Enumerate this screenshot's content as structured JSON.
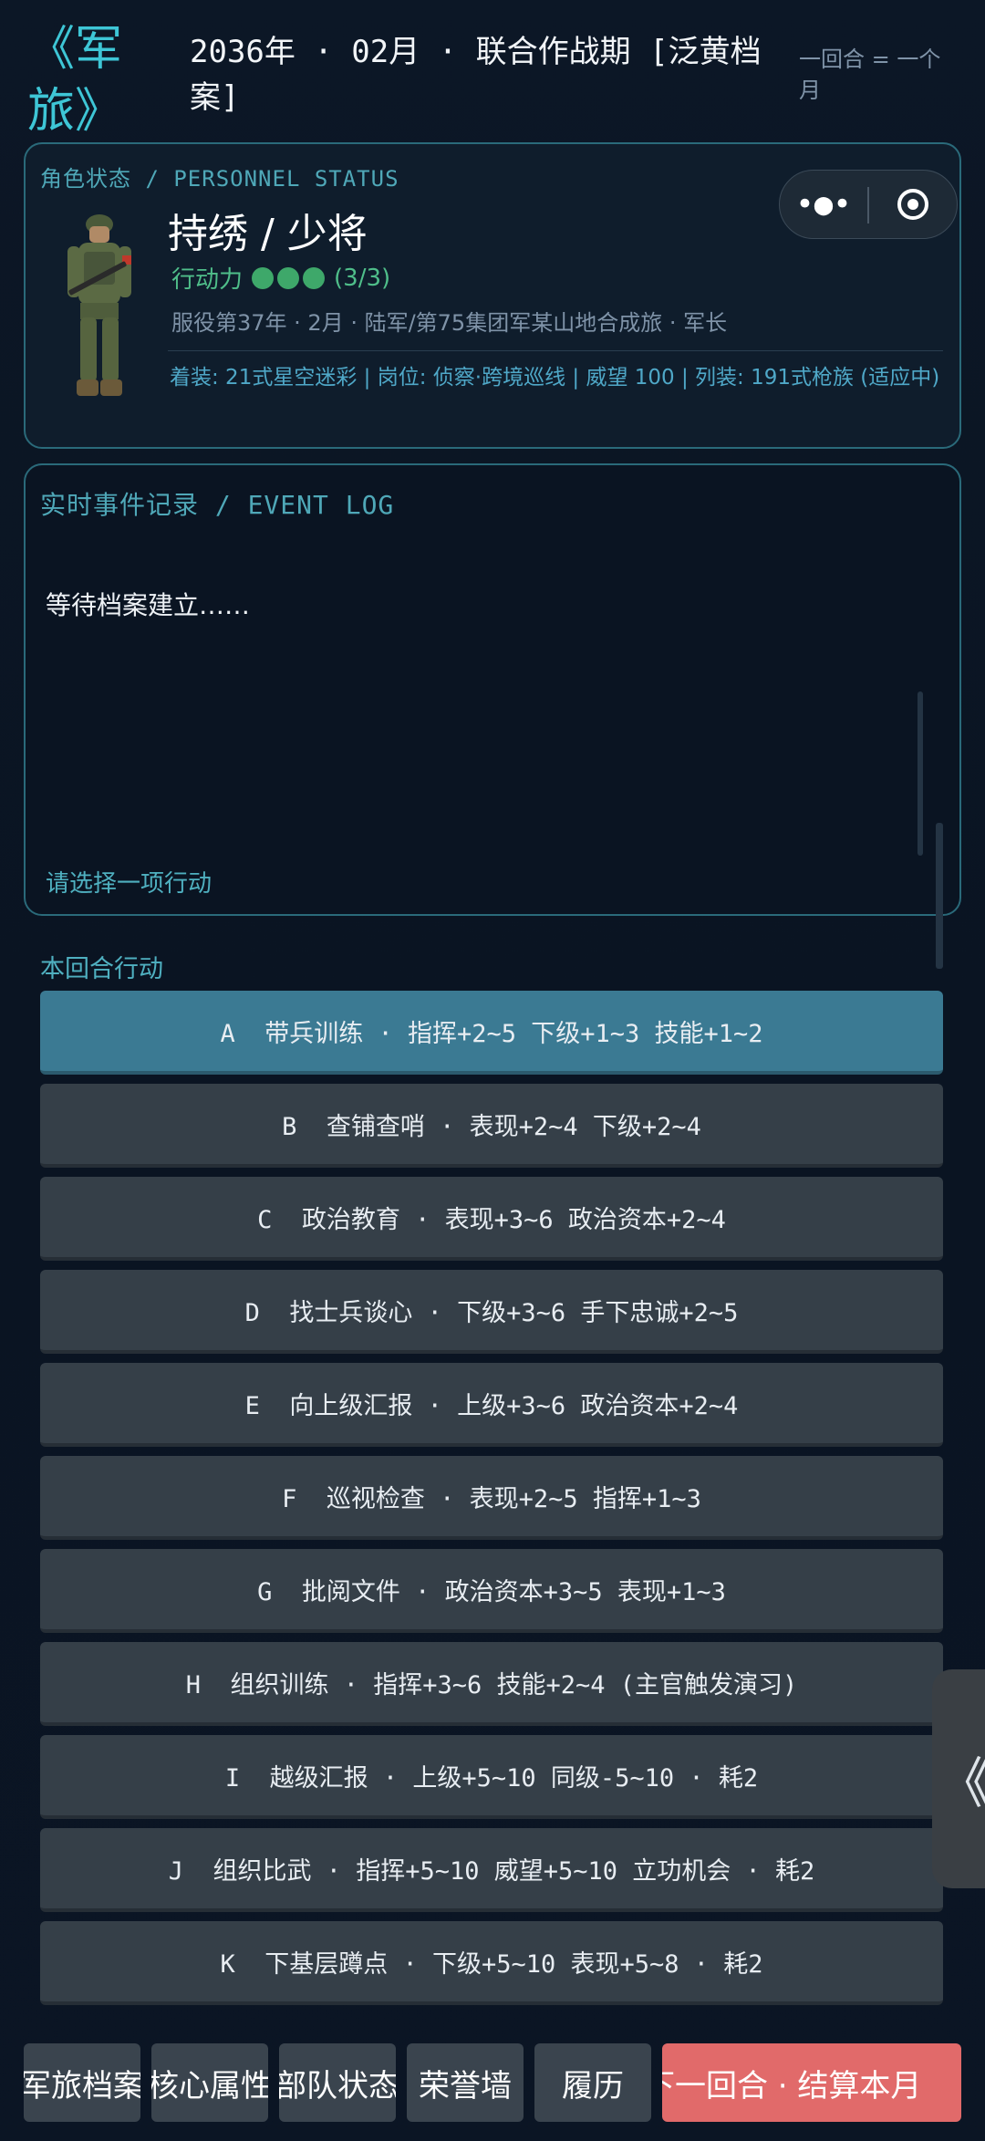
{
  "header": {
    "logo": "《军旅》",
    "date_line": "2036年 · 02月 · 联合作战期 [泛黄档案]",
    "period_note": "一回合 = 一个月"
  },
  "personnel": {
    "section_label": "角色状态 / PERSONNEL STATUS",
    "name_rank": "持绣  /  少将",
    "action_label": "行动力",
    "action_points": 3,
    "action_count": "(3/3)",
    "service": "服役第37年 · 2月 · 陆军/第75集团军某山地合成旅 · 军长",
    "details": "着装: 21式星空迷彩 | 岗位: 侦察·跨境巡线 | 威望 100 | 列装: 191式枪族 (适应中)"
  },
  "capsule": {
    "more_icon": "more-dots-icon",
    "target_icon": "target-icon"
  },
  "event_log": {
    "section_label": "实时事件记录 / EVENT LOG",
    "message": "等待档案建立……",
    "prompt": "请选择一项行动"
  },
  "actions": {
    "title": "本回合行动",
    "items": [
      {
        "label": "A  带兵训练 · 指挥+2~5 下级+1~3 技能+1~2",
        "selected": true
      },
      {
        "label": "B  查铺查哨 · 表现+2~4 下级+2~4",
        "selected": false
      },
      {
        "label": "C  政治教育 · 表现+3~6 政治资本+2~4",
        "selected": false
      },
      {
        "label": "D  找士兵谈心 · 下级+3~6 手下忠诚+2~5",
        "selected": false
      },
      {
        "label": "E  向上级汇报 · 上级+3~6 政治资本+2~4",
        "selected": false
      },
      {
        "label": "F  巡视检查 · 表现+2~5 指挥+1~3",
        "selected": false
      },
      {
        "label": "G  批阅文件 · 政治资本+3~5 表现+1~3",
        "selected": false
      },
      {
        "label": "H  组织训练 · 指挥+3~6 技能+2~4 (主官触发演习)",
        "selected": false
      },
      {
        "label": "I  越级汇报 · 上级+5~10 同级-5~10 · 耗2",
        "selected": false
      },
      {
        "label": "J  组织比武 · 指挥+5~10 威望+5~10 立功机会 · 耗2",
        "selected": false
      },
      {
        "label": "K  下基层蹲点 · 下级+5~10 表现+5~8 · 耗2",
        "selected": false
      }
    ]
  },
  "side_tab": {
    "label": "《"
  },
  "bottom_nav": {
    "items": [
      "军旅档案",
      "核心属性",
      "部队状态",
      "荣誉墙",
      "履历"
    ],
    "end_turn": "下一回合 · 结算本月"
  },
  "colors": {
    "accent": "#3ec6d6",
    "selected": "#3b7a93",
    "end_turn": "#e16a6a",
    "ap_green": "#3ea86a"
  }
}
